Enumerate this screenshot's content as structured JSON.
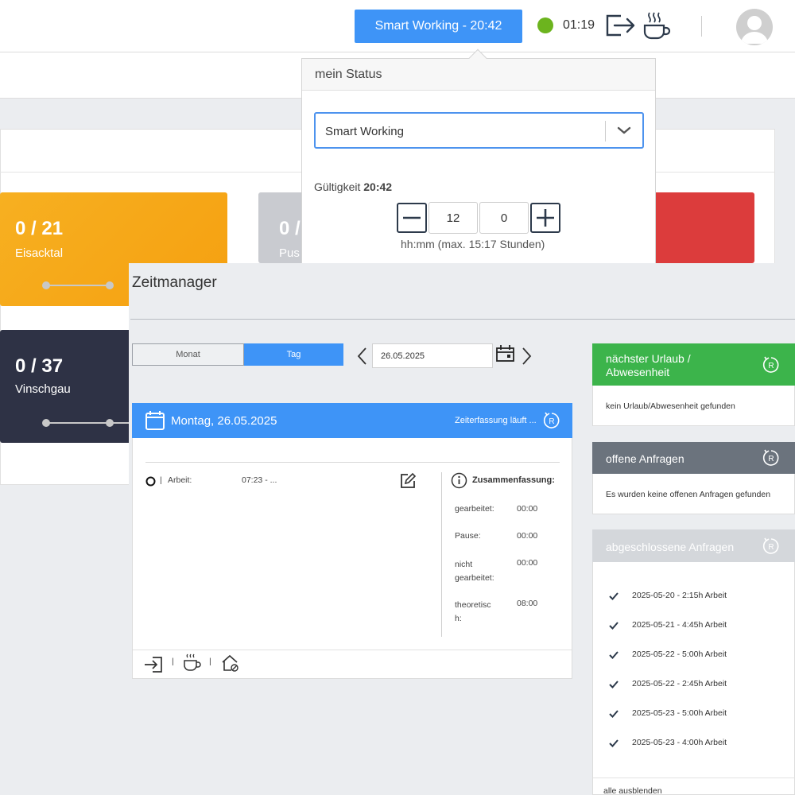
{
  "topbar": {
    "status_button": "Smart Working - 20:42",
    "timer": "01:19"
  },
  "dashboard": {
    "tiles": [
      {
        "count": "0 / 21",
        "label": "Eisacktal",
        "color": "#f5a010"
      },
      {
        "count": "0 /",
        "label": "Pus",
        "color": "#c9cbd0"
      },
      {
        "count": "0 / 37",
        "label": "Vinschgau",
        "color": "#2e3245"
      },
      {
        "color": "#dc3c3c"
      }
    ]
  },
  "status_popover": {
    "title": "mein Status",
    "selected": "Smart Working",
    "validity_label": "Gültigkeit",
    "validity_value": "20:42",
    "hours": "12",
    "minutes": "0",
    "hint": "hh:mm (max. 15:17 Stunden)"
  },
  "zeitmanager": {
    "title": "Zeitmanager",
    "view_month": "Monat",
    "view_day": "Tag",
    "date": "26.05.2025",
    "day_card": {
      "title": "Montag, 26.05.2025",
      "status": "Zeiterfassung läuft ...",
      "entry_sep": "|",
      "entry_label": "Arbeit:",
      "entry_time": "07:23 - ...",
      "summary_title": "Zusammenfassung:",
      "summary": [
        {
          "label": "gearbeitet:",
          "value": "00:00"
        },
        {
          "label": "Pause:",
          "value": "00:00"
        },
        {
          "label": "nicht gearbeitet:",
          "value": "00:00"
        },
        {
          "label": "theoretisch:",
          "value": "08:00"
        }
      ],
      "footer_sep": "|"
    },
    "vacation": {
      "title": "nächster Urlaub / Abwesenheit",
      "body": "kein Urlaub/Abwesenheit gefunden",
      "color": "#3cb44b"
    },
    "open_requests": {
      "title": "offene Anfragen",
      "body": "Es wurden keine offenen Anfragen gefunden",
      "color": "#6b737d"
    },
    "closed_requests": {
      "title": "abgeschlossene Anfragen",
      "color": "#d4d7db",
      "items": [
        "2025-05-20 - 2:15h Arbeit",
        "2025-05-21 - 4:45h Arbeit",
        "2025-05-22 - 5:00h Arbeit",
        "2025-05-22 - 2:45h Arbeit",
        "2025-05-23 - 5:00h Arbeit",
        "2025-05-23 - 4:00h Arbeit"
      ],
      "hide_all": "alle ausblenden"
    }
  }
}
